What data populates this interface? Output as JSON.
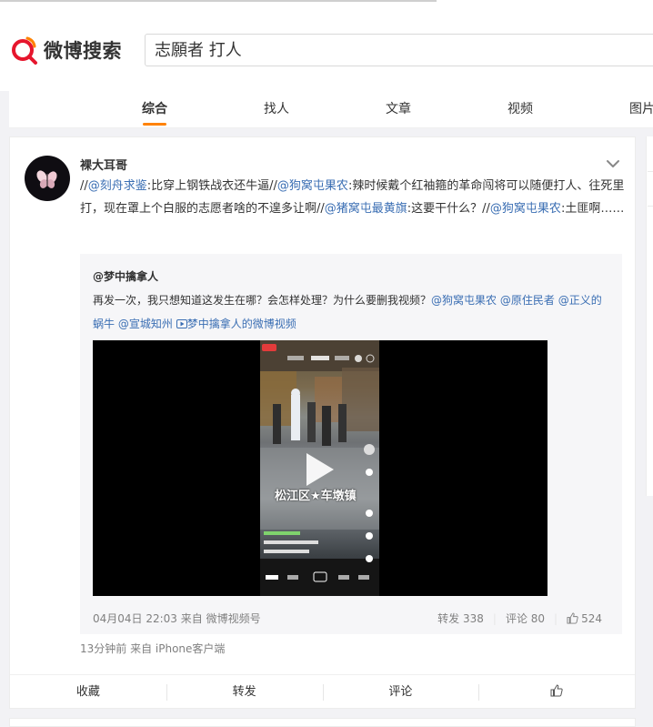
{
  "brand": {
    "logo_text": "微博搜索",
    "accent": "#ff8200"
  },
  "search": {
    "value": "志願者 打人"
  },
  "tabs": [
    {
      "label": "综合",
      "active": true
    },
    {
      "label": "找人",
      "active": false
    },
    {
      "label": "文章",
      "active": false
    },
    {
      "label": "视频",
      "active": false
    },
    {
      "label": "图片",
      "active": false
    }
  ],
  "post": {
    "author": "裸大耳哥",
    "text": {
      "p1": "//",
      "m1": "@刻舟求鉴",
      "t1": ":比穿上钢铁战衣还牛逼//",
      "m2": "@狗窝屯果农",
      "t2": ":辣时候戴个红袖箍的革命闯将可以随便打人、往死里打，现在罩上个白服的志愿者啥的不遑多让啊//",
      "m3": "@猪窝屯最黄旗",
      "t3": ":这要干什么？//",
      "m4": "@狗窝屯果农",
      "t4": ":土匪啊……"
    },
    "meta": "13分钟前  来自 iPhone客户端",
    "actions": {
      "favorite": "收藏",
      "repost": "转发",
      "comment": "评论"
    }
  },
  "repost": {
    "author": "@梦中擒拿人",
    "text": "再发一次，我只想知道这发生在哪？会怎样处理？为什么要删我视频？",
    "mentions": [
      "@狗窝屯果农",
      "@原住民者",
      "@正义的蜗牛",
      "@宣城知州"
    ],
    "video_link": "梦中擒拿人的微博视频",
    "video_banner": "松江区★车墩镇",
    "meta": "04月04日 22:03 来自 微博视频号",
    "stats": {
      "repost": "转发 338",
      "comment": "评论 80",
      "like": "524"
    }
  }
}
